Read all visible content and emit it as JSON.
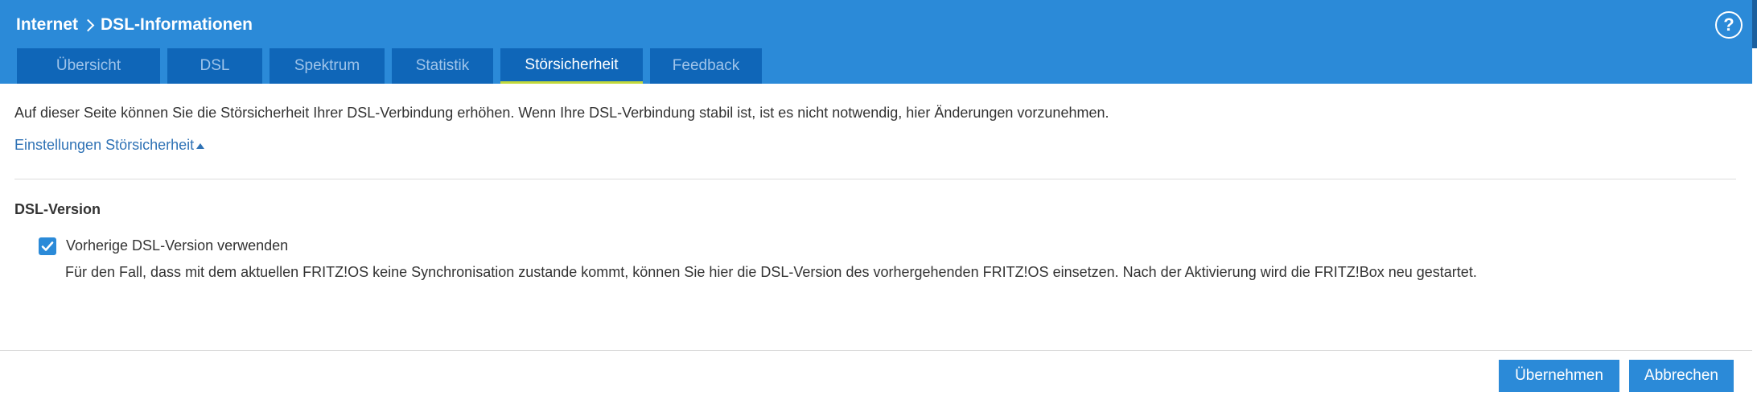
{
  "header": {
    "breadcrumb": [
      "Internet",
      "DSL-Informationen"
    ],
    "help_symbol": "?"
  },
  "tabs": [
    {
      "label": "Übersicht",
      "active": false
    },
    {
      "label": "DSL",
      "active": false
    },
    {
      "label": "Spektrum",
      "active": false
    },
    {
      "label": "Statistik",
      "active": false
    },
    {
      "label": "Störsicherheit",
      "active": true
    },
    {
      "label": "Feedback",
      "active": false
    }
  ],
  "content": {
    "intro": "Auf dieser Seite können Sie die Störsicherheit Ihrer DSL-Verbindung erhöhen. Wenn Ihre DSL-Verbindung stabil ist, ist es nicht notwendig, hier Änderungen vorzunehmen.",
    "settings_link": "Einstellungen Störsicherheit",
    "section_title": "DSL-Version",
    "checkbox_label": "Vorherige DSL-Version verwenden",
    "checkbox_checked": true,
    "checkbox_description": "Für den Fall, dass mit dem aktuellen FRITZ!OS keine Synchronisation zustande kommt, können Sie hier die DSL-Version des vorhergehenden FRITZ!OS einsetzen. Nach der Aktivierung wird die FRITZ!Box neu gestartet."
  },
  "buttons": {
    "apply": "Übernehmen",
    "cancel": "Abbrechen"
  },
  "icons": {
    "breadcrumb_separator": "chevron-right-icon",
    "help": "help-icon",
    "checkbox": "checkmark-icon",
    "settings_link_caret": "caret-up-icon"
  },
  "colors": {
    "header": "#2b8ad8",
    "tab": "#0f66b8",
    "tab_active_underline": "#c2d93b",
    "link": "#2f72b5",
    "button": "#2b8ad8"
  }
}
